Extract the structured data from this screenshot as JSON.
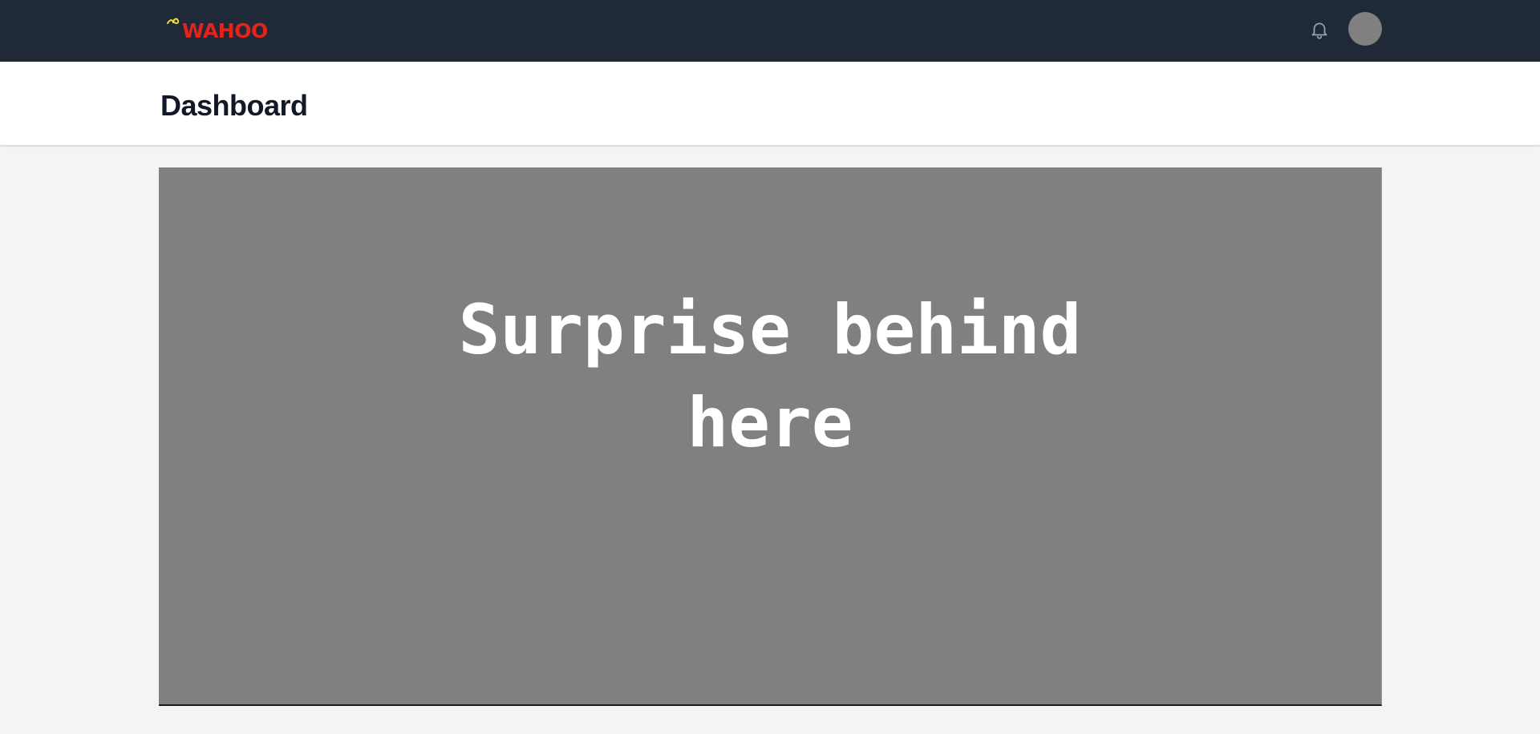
{
  "topbar": {
    "logo_text": "WAHOO",
    "icons": {
      "bell": "bell-icon",
      "avatar": "avatar"
    },
    "colors": {
      "background": "#1f2937",
      "logo": "#e5231b",
      "logo_spark": "#e8e336",
      "avatar": "#808080"
    }
  },
  "header": {
    "title": "Dashboard"
  },
  "main": {
    "panel_text": "Surprise behind here",
    "colors": {
      "panel_background": "#808080",
      "page_background": "#f3f4f6"
    }
  }
}
